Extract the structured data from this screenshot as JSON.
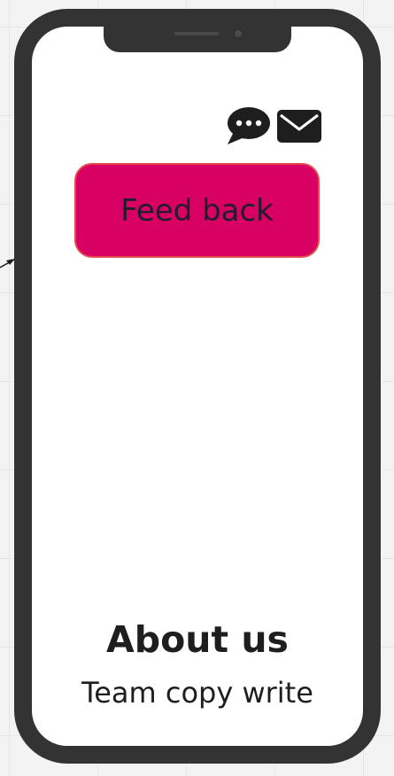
{
  "screen": {
    "feedback_button_label": "Feed back",
    "about_title": "About us",
    "about_subtitle": "Team copy write"
  },
  "icons": {
    "chat": "chat-bubble-dots-icon",
    "mail": "envelope-icon"
  },
  "colors": {
    "button_fill": "#d80063",
    "button_border": "#e4494b",
    "phone_frame": "#333333",
    "icon": "#1e1e1e"
  }
}
